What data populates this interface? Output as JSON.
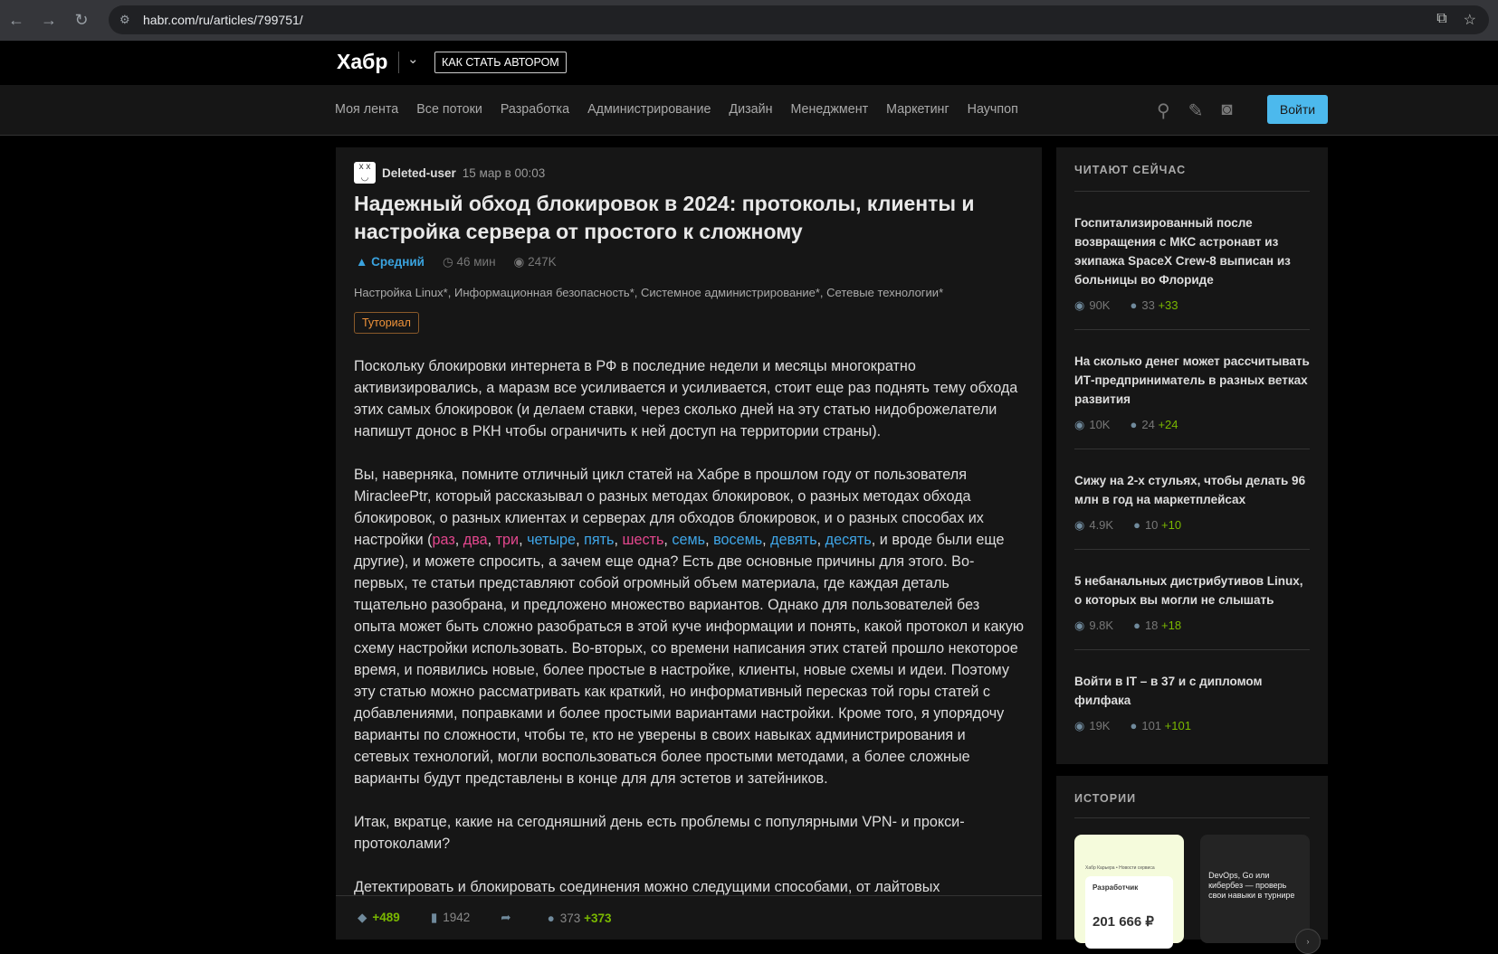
{
  "browser": {
    "url": "habr.com/ru/articles/799751/"
  },
  "header": {
    "logo": "Хабр",
    "author_button": "КАК СТАТЬ АВТОРОМ"
  },
  "nav": {
    "items": [
      "Моя лента",
      "Все потоки",
      "Разработка",
      "Администрирование",
      "Дизайн",
      "Менеджмент",
      "Маркетинг",
      "Научпоп"
    ],
    "login": "Войти"
  },
  "article": {
    "author": "Deleted-user",
    "date": "15 мар в 00:03",
    "title": "Надежный обход блокировок в 2024: протоколы, клиенты и настройка сервера от простого к сложному",
    "level": "Средний",
    "read_time": "46 мин",
    "views": "247K",
    "hubs": "Настройка Linux*, Информационная безопасность*, Системное администрирование*, Сетевые технологии*",
    "badge": "Туториал",
    "p1_text": "Поскольку блокировки интернета в РФ в последние недели и месяцы многократно активизировались, а маразм все усиливается и усиливается, стоит еще раз поднять тему обхода этих самых блокировок (и делаем ставки, через сколько дней на эту статью нидоброжелатели напишут донос в РКН чтобы ограничить к ней доступ на территории страны).",
    "p2_start": "Вы, наверняка, помните отличный цикл статей на Хабре в прошлом году от пользователя MiracleePtr, который рассказывал о разных методах блокировок, о разных методах обхода блокировок, о разных клиентах и серверах для обходов блокировок, и о разных способах их настройки (",
    "links": [
      "раз",
      "два",
      "три",
      "четыре",
      "пять",
      "шесть",
      "семь",
      "восемь",
      "девять",
      "десять"
    ],
    "p2_end": ", и вроде были еще другие), и можете спросить, а зачем еще одна? Есть две основные причины для этого. Во-первых, те статьи представляют собой огромный объем материала, где каждая деталь тщательно разобрана, и предложено множество вариантов. Однако для пользователей без опыта может быть сложно разобраться в этой куче информации и понять, какой протокол и какую схему настройки использовать. Во-вторых, со времени написания этих статей прошло некоторое время, и появились новые, более простые в настройке, клиенты, новые схемы и идеи. Поэтому эту статью можно рассматривать как краткий, но информативный пересказ той горы статей с добавлениями, поправками и более простыми вариантами настройки. Кроме того, я упорядочу варианты по сложности, чтобы те, кто не уверены в своих навыках администрирования и сетевых технологий, могли воспользоваться более простыми методами, а более сложные варианты будут представлены в конце для для эстетов и затейников.",
    "p3": "Итак, вкратце, какие на сегодняшний день есть проблемы с популярными VPN- и прокси-протоколами?",
    "p4": "Детектировать и блокировать соединения можно следущими способами, от лайтовых",
    "votes": "+489",
    "bookmarks": "1942",
    "comments": "373",
    "comments_new": "+373"
  },
  "sidebar": {
    "title": "ЧИТАЮТ СЕЙЧАС",
    "posts": [
      {
        "title": "Госпитализированный после возвращения с МКС астронавт из экипажа SpaceX Crew-8 выписан из больницы во Флориде",
        "views": "90K",
        "comments": "33",
        "new": "+33"
      },
      {
        "title": "На сколько денег может рассчитывать ИТ-предприниматель в разных ветках развития",
        "views": "10K",
        "comments": "24",
        "new": "+24"
      },
      {
        "title": "Сижу на 2-х стульях, чтобы делать 96 млн в год на маркетплейсах",
        "views": "4.9K",
        "comments": "10",
        "new": "+10"
      },
      {
        "title": "5 небанальных дистрибутивов Linux, о которых вы могли не слышать",
        "views": "9.8K",
        "comments": "18",
        "new": "+18"
      },
      {
        "title": "Войти в IT – в 37 и с дипломом филфака",
        "views": "19K",
        "comments": "101",
        "new": "+101"
      }
    ]
  },
  "stories": {
    "title": "ИСТОРИИ",
    "card1_tiny": "Хабр Карьера • Новости сервиса",
    "card1_role": "Разработчик",
    "card1_salary": "201 666 ₽",
    "card2_text": "DevOps, Go или кибербез — проверь свои навыки в турнире"
  }
}
